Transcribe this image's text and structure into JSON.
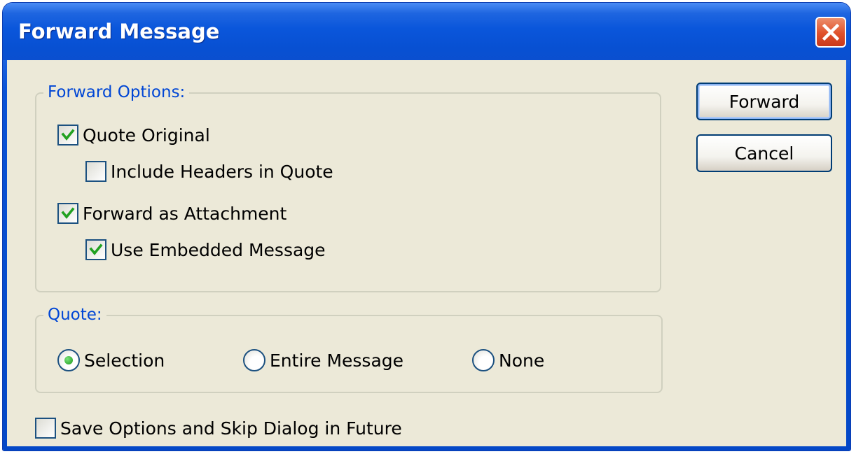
{
  "window": {
    "title": "Forward Message",
    "close_icon": "close-icon"
  },
  "forward_options": {
    "legend": "Forward Options:",
    "quote_original": {
      "label": "Quote Original",
      "checked": true
    },
    "include_headers": {
      "label": "Include Headers in Quote",
      "checked": false
    },
    "forward_as_attachment": {
      "label": "Forward as Attachment",
      "checked": true
    },
    "use_embedded": {
      "label": "Use Embedded Message",
      "checked": true
    }
  },
  "quote": {
    "legend": "Quote:",
    "selected": "Selection",
    "options": [
      {
        "label": "Selection",
        "selected": true
      },
      {
        "label": "Entire Message",
        "selected": false
      },
      {
        "label": "None",
        "selected": false
      }
    ]
  },
  "save_options": {
    "label": "Save Options and Skip Dialog in Future",
    "checked": false
  },
  "buttons": {
    "forward_label": "Forward",
    "cancel_label": "Cancel"
  },
  "colors": {
    "title_bar": "#0a56db",
    "dialog_background": "#ece9d8",
    "group_legend": "#0046d5",
    "check_mark": "#21a121",
    "close_button": "#e0512b"
  }
}
